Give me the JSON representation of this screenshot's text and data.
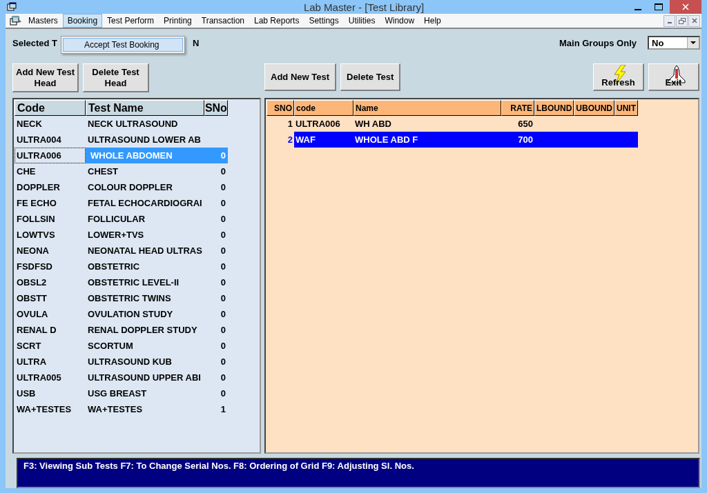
{
  "window": {
    "title": "Lab Master - [Test Library]"
  },
  "menu": [
    {
      "label": "Masters",
      "selected": false
    },
    {
      "label": "Booking",
      "selected": true,
      "submenu": [
        "Accept Test Booking"
      ]
    },
    {
      "label": "Test Perform",
      "selected": false
    },
    {
      "label": "Printing",
      "selected": false
    },
    {
      "label": "Transaction",
      "selected": false
    },
    {
      "label": "Lab Reports",
      "selected": false
    },
    {
      "label": "Settings",
      "selected": false
    },
    {
      "label": "Utilities",
      "selected": false
    },
    {
      "label": "Window",
      "selected": false
    },
    {
      "label": "Help",
      "selected": false
    }
  ],
  "selected_label": {
    "visible_start": "Selected T",
    "visible_end": "N"
  },
  "main_groups_only": {
    "label": "Main Groups Only",
    "value": "No"
  },
  "head_buttons": [
    "Add New Test Head",
    "Delete Test Head"
  ],
  "test_buttons": [
    "Add New Test",
    "Delete Test"
  ],
  "tool_buttons": [
    {
      "kind": "refresh",
      "label": "Refresh"
    },
    {
      "kind": "exit",
      "label": "Exit"
    }
  ],
  "heads_table": {
    "columns": [
      "Code",
      "Test Name",
      "SNo"
    ],
    "rows": [
      {
        "code": "NECK",
        "name": "NECK  ULTRASOUND",
        "selected": false
      },
      {
        "code": "ULTRA004",
        "name": "ULTRASOUND LOWER AB",
        "selected": false
      },
      {
        "code": "ULTRA006",
        "name": "WHOLE ABDOMEN",
        "sno": "0",
        "selected": true
      },
      {
        "code": "CHE",
        "name": "CHEST",
        "sno": "0",
        "selected": false
      },
      {
        "code": "DOPPLER",
        "name": "COLOUR DOPPLER",
        "sno": "0",
        "selected": false
      },
      {
        "code": "FE ECHO",
        "name": "FETAL ECHOCARDIOGRAI",
        "sno": "0",
        "selected": false
      },
      {
        "code": "FOLLSIN",
        "name": "FOLLICULAR",
        "sno": "0",
        "selected": false
      },
      {
        "code": "LOWTVS",
        "name": "LOWER+TVS",
        "sno": "0",
        "selected": false
      },
      {
        "code": "NEONA",
        "name": "NEONATAL HEAD ULTRAS",
        "sno": "0",
        "selected": false
      },
      {
        "code": "FSDFSD",
        "name": "OBSTETRIC",
        "sno": "0",
        "selected": false
      },
      {
        "code": "OBSL2",
        "name": "OBSTETRIC LEVEL-II",
        "sno": "0",
        "selected": false
      },
      {
        "code": "OBSTT",
        "name": "OBSTETRIC TWINS",
        "sno": "0",
        "selected": false
      },
      {
        "code": "OVULA",
        "name": "OVULATION STUDY",
        "sno": "0",
        "selected": false
      },
      {
        "code": "RENAL D",
        "name": "RENAL DOPPLER STUDY",
        "sno": "0",
        "selected": false
      },
      {
        "code": "SCRT",
        "name": "SCORTUM",
        "sno": "0",
        "selected": false
      },
      {
        "code": "ULTRA",
        "name": "ULTRASOUND KUB",
        "sno": "0",
        "selected": false
      },
      {
        "code": "ULTRA005",
        "name": "ULTRASOUND UPPER ABI",
        "sno": "0",
        "selected": false
      },
      {
        "code": "USB",
        "name": "USG BREAST",
        "sno": "0",
        "selected": false
      },
      {
        "code": "WA+TESTES",
        "name": "WA+TESTES",
        "sno": "1",
        "selected": false
      }
    ]
  },
  "tests_table": {
    "columns": [
      "SNO",
      "code",
      "Name",
      "RATE",
      "LBOUND",
      "UBOUND",
      "UNIT"
    ],
    "rows": [
      {
        "sno": "1",
        "code": "ULTRA006",
        "name": "WH ABD",
        "rate": "650",
        "selected": false
      },
      {
        "sno": "2",
        "code": "WAF",
        "name": "WHOLE ABD F",
        "rate": "700",
        "selected": true
      }
    ]
  },
  "status_bar": "F3: Viewing Sub Tests  F7: To Change Serial Nos. F8: Ordering of Grid  F9: Adjusting Sl. Nos."
}
